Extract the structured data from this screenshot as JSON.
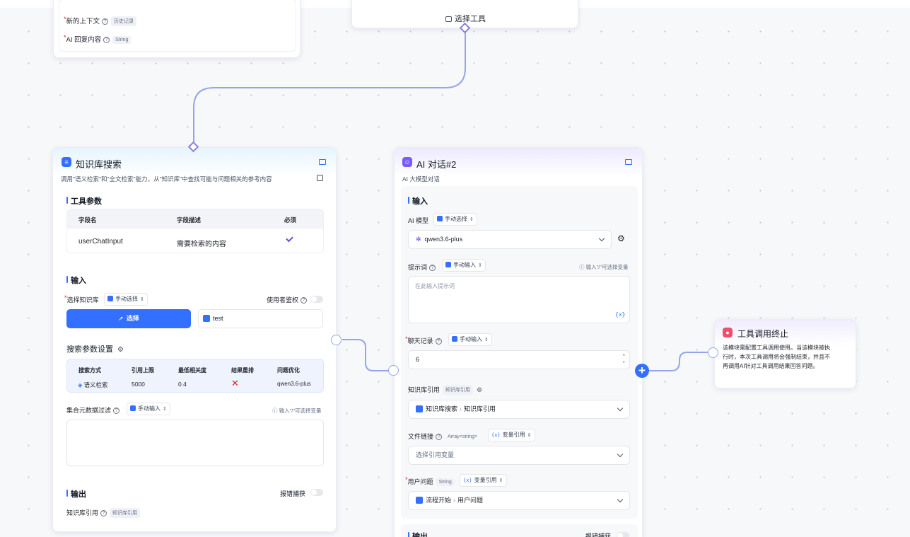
{
  "colors": {
    "accent": "#3370ff",
    "edge": "#94a5e8",
    "handle": "#8a7dde",
    "error": "#e02424"
  },
  "node_top_left": {
    "field_new_context": "新的上下文",
    "tag_history": "历史记录",
    "field_ai_reply": "AI 回复内容",
    "tag_string": "String"
  },
  "node_top_mid": {
    "select_tool": "选择工具",
    "icon": "tool-icon"
  },
  "kb_node": {
    "title": "知识库搜索",
    "desc": "调用\"语义检索\"和\"全文检索\"能力，从\"知识库\"中查找可能与问题相关的参考内容",
    "tool_params": "工具参数",
    "table_headers": [
      "字段名",
      "字段描述",
      "必须"
    ],
    "table_row": {
      "name": "userChatInput",
      "desc": "需要检索的内容"
    },
    "input_title": "输入",
    "select_kb_label": "选择知识库",
    "manual_select": "手动选择",
    "user_auth_label": "使用者鉴权",
    "select_button": "选择",
    "selected_kb": "test",
    "search_params_title": "搜索参数设置",
    "search_headers": [
      "搜索方式",
      "引用上限",
      "最低相关度",
      "结果重排",
      "问题优化"
    ],
    "search_row": {
      "mode": "语义检索",
      "limit": "5000",
      "min_score": "0.4",
      "model": "qwen3.6-plus"
    },
    "metadata_filter_label": "集合元数据过滤",
    "manual_input": "手动输入",
    "hint_input": "输入\"/\"可选择变量",
    "output_title": "输出",
    "catch_error": "报错捕获",
    "kb_quote_label": "知识库引用",
    "kb_quote_tag": "知识库引用"
  },
  "ai_node": {
    "title": "AI 对话#2",
    "desc": "AI 大模型对话",
    "input_title": "输入",
    "ai_model_label": "AI 模型",
    "manual_select": "手动选择",
    "model_value": "qwen3.6-plus",
    "prompt_label": "提示词",
    "manual_input": "手动输入",
    "hint_input": "输入\"/\"可选择变量",
    "prompt_placeholder": "在此输入提示词",
    "brace_icon": "{x}",
    "chat_history_label": "聊天记录",
    "chat_history_value": "6",
    "kb_quote_label": "知识库引用",
    "kb_quote_tag": "知识库引用",
    "kb_quote_value_a": "知识库搜索",
    "kb_quote_value_b": "知识库引用",
    "file_link_label": "文件链接",
    "file_link_tag": "Array<string>",
    "var_ref": "变量引用",
    "file_link_placeholder": "选择引用变量",
    "user_question_label": "用户问题",
    "user_question_tag": "String",
    "user_question_value_a": "流程开始",
    "user_question_value_b": "用户问题",
    "output_title": "输出",
    "catch_error": "报错捕获"
  },
  "end_node": {
    "title": "工具调用终止",
    "desc": "该模块需配置工具调用使用。当该模块被执行时，本次工具调用将会强制结束，并且不再调用AI针对工具调用结果回答问题。"
  }
}
